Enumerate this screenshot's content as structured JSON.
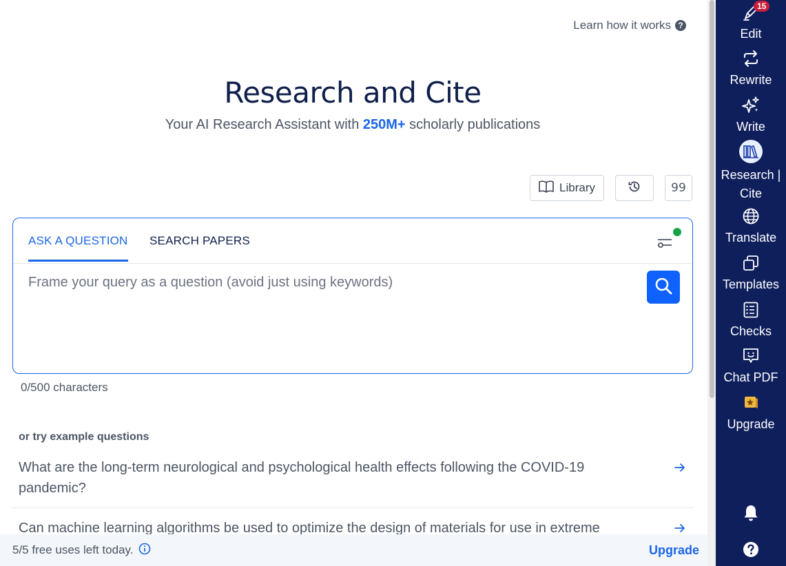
{
  "header": {
    "learn_link": "Learn how it works",
    "title": "Research and Cite",
    "subtitle_prefix": "Your AI Research Assistant with ",
    "subtitle_highlight": "250M+",
    "subtitle_suffix": " scholarly publications"
  },
  "toolbar": {
    "library_label": "Library",
    "history_icon": "history-icon",
    "cite_label": "99"
  },
  "search": {
    "tabs": [
      {
        "label": "ASK A QUESTION",
        "active": true
      },
      {
        "label": "SEARCH PAPERS",
        "active": false
      }
    ],
    "placeholder": "Frame your query as a question (avoid just using keywords)",
    "value": "",
    "char_count": "0/500 characters"
  },
  "examples": {
    "heading": "or try example questions",
    "items": [
      "What are the long-term neurological and psychological health effects following the COVID-19 pandemic?",
      "Can machine learning algorithms be used to optimize the design of materials for use in extreme"
    ]
  },
  "footer": {
    "uses_text": "5/5 free uses left today.",
    "upgrade_label": "Upgrade"
  },
  "rail": {
    "badge": "15",
    "items": [
      {
        "label": "Edit",
        "icon": "pen-icon"
      },
      {
        "label": "Rewrite",
        "icon": "rewrite-icon"
      },
      {
        "label": "Write",
        "icon": "sparkle-icon"
      },
      {
        "label": "Research |",
        "label2": "Cite",
        "icon": "books-icon",
        "active": true
      },
      {
        "label": "Translate",
        "icon": "globe-icon"
      },
      {
        "label": "Templates",
        "icon": "templates-icon"
      },
      {
        "label": "Checks",
        "icon": "checklist-icon"
      },
      {
        "label": "Chat PDF",
        "icon": "chat-icon"
      },
      {
        "label": "Upgrade",
        "icon": "crown-icon"
      }
    ]
  },
  "colors": {
    "brand_blue": "#1a65e8",
    "rail_bg": "#0f1f5c",
    "title": "#0f1f4b",
    "status_green": "#16a34a",
    "badge_red": "#c81e3a"
  }
}
